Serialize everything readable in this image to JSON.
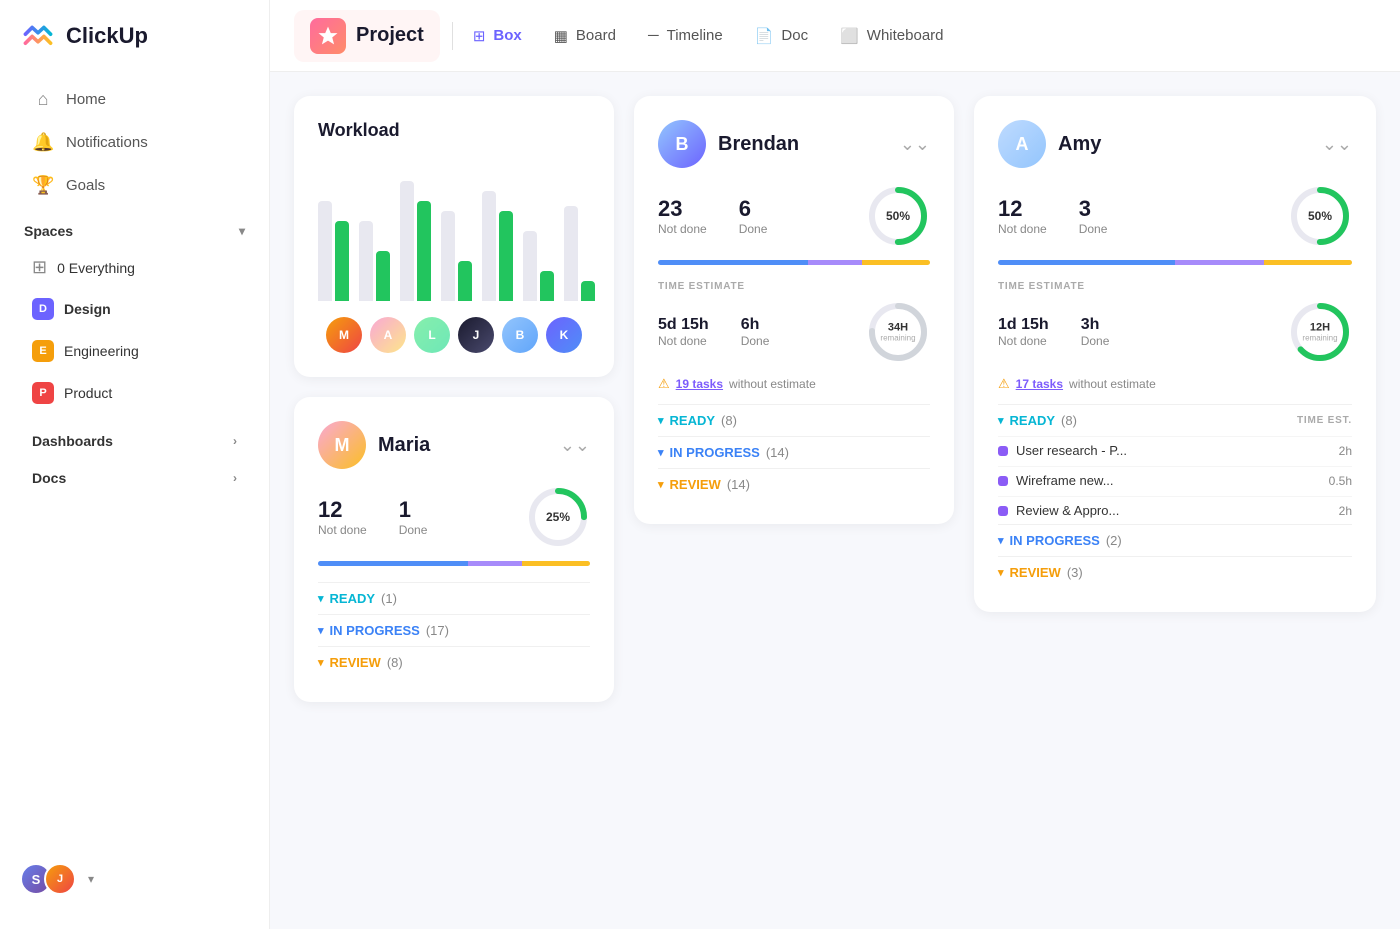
{
  "sidebar": {
    "logo_text": "ClickUp",
    "nav": [
      {
        "id": "home",
        "label": "Home",
        "icon": "⌂"
      },
      {
        "id": "notifications",
        "label": "Notifications",
        "icon": "🔔"
      },
      {
        "id": "goals",
        "label": "Goals",
        "icon": "🏆"
      }
    ],
    "spaces_label": "Spaces",
    "everything_label": "0 Everything",
    "spaces": [
      {
        "id": "design",
        "label": "Design",
        "letter": "D",
        "color": "#6c63ff",
        "bold": true
      },
      {
        "id": "engineering",
        "label": "Engineering",
        "letter": "E",
        "color": "#f59e0b"
      },
      {
        "id": "product",
        "label": "Product",
        "letter": "P",
        "color": "#ef4444"
      }
    ],
    "dashboards_label": "Dashboards",
    "docs_label": "Docs"
  },
  "header": {
    "project_label": "Project",
    "nav_items": [
      {
        "id": "box",
        "label": "Box",
        "icon": "⊞"
      },
      {
        "id": "board",
        "label": "Board",
        "icon": "▦"
      },
      {
        "id": "timeline",
        "label": "Timeline",
        "icon": "—"
      },
      {
        "id": "doc",
        "label": "Doc",
        "icon": "📄"
      },
      {
        "id": "whiteboard",
        "label": "Whiteboard",
        "icon": "⬜"
      }
    ]
  },
  "workload": {
    "title": "Workload",
    "bars": [
      {
        "gray": 100,
        "green": 80
      },
      {
        "gray": 80,
        "green": 50
      },
      {
        "gray": 120,
        "green": 100
      },
      {
        "gray": 90,
        "green": 40
      },
      {
        "gray": 110,
        "green": 90
      },
      {
        "gray": 70,
        "green": 30
      },
      {
        "gray": 95,
        "green": 20
      }
    ]
  },
  "brendan": {
    "name": "Brendan",
    "not_done": "23",
    "not_done_label": "Not done",
    "done": "6",
    "done_label": "Done",
    "percent": "50%",
    "percent_num": 50,
    "time_estimate_label": "TIME ESTIMATE",
    "not_done_time": "5d 15h",
    "done_time": "6h",
    "remaining": "34H",
    "remaining_label": "remaining",
    "warning_tasks": "19 tasks",
    "warning_text": "without estimate",
    "sections": [
      {
        "id": "ready",
        "label": "READY",
        "count": "(8)",
        "color": "cyan"
      },
      {
        "id": "inprogress",
        "label": "IN PROGRESS",
        "count": "(14)",
        "color": "blue"
      },
      {
        "id": "review",
        "label": "REVIEW",
        "count": "(14)",
        "color": "yellow"
      }
    ]
  },
  "maria": {
    "name": "Maria",
    "not_done": "12",
    "not_done_label": "Not done",
    "done": "1",
    "done_label": "Done",
    "percent": "25%",
    "percent_num": 25,
    "sections": [
      {
        "id": "ready",
        "label": "READY",
        "count": "(1)",
        "color": "cyan"
      },
      {
        "id": "inprogress",
        "label": "IN PROGRESS",
        "count": "(17)",
        "color": "blue"
      },
      {
        "id": "review",
        "label": "REVIEW",
        "count": "(8)",
        "color": "yellow"
      }
    ]
  },
  "amy": {
    "name": "Amy",
    "not_done": "12",
    "not_done_label": "Not done",
    "done": "3",
    "done_label": "Done",
    "percent": "50%",
    "percent_num": 50,
    "time_estimate_label": "TIME ESTIMATE",
    "time_est_col": "TIME EST.",
    "not_done_time": "1d 15h",
    "done_time": "3h",
    "remaining": "12H",
    "remaining_label": "remaining",
    "warning_tasks": "17 tasks",
    "warning_text": "without estimate",
    "sections": [
      {
        "id": "ready",
        "label": "READY",
        "count": "(8)",
        "color": "cyan"
      },
      {
        "id": "inprogress",
        "label": "IN PROGRESS",
        "count": "(2)",
        "color": "blue"
      },
      {
        "id": "review",
        "label": "REVIEW",
        "count": "(3)",
        "color": "yellow"
      }
    ],
    "tasks": [
      {
        "label": "User research - P...",
        "time": "2h",
        "color": "#8b5cf6"
      },
      {
        "label": "Wireframe new...",
        "time": "0.5h",
        "color": "#8b5cf6"
      },
      {
        "label": "Review & Appro...",
        "time": "2h",
        "color": "#8b5cf6"
      }
    ]
  }
}
